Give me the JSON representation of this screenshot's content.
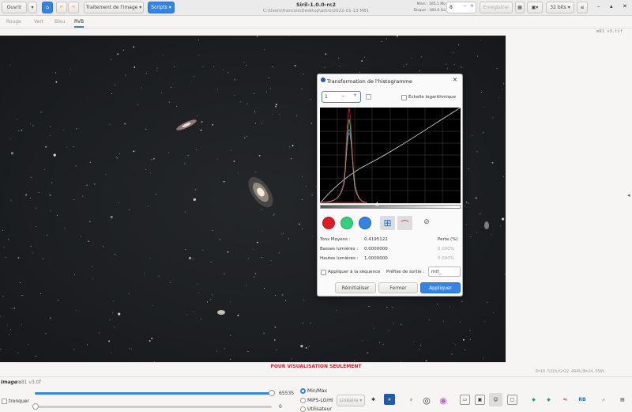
{
  "header": {
    "open_label": "Ouvrir",
    "image_processing_label": "Traitement de l'image",
    "scripts_label": "Scripts",
    "app_title": "Siril-1.0.0-rc2",
    "path": "C:\\Users\\francois\\Desktop\\astro\\2022-01-13 M81",
    "mem_label": "Mem : 185.1 Mo",
    "disk_label": "Disque : 383.0 Go",
    "threads_value": "8",
    "save_label": "Enregistrer",
    "bits_label": "32 bits"
  },
  "tabs": [
    {
      "label": "Rouge"
    },
    {
      "label": "Vert"
    },
    {
      "label": "Bleu"
    },
    {
      "label": "RVB"
    }
  ],
  "image": {
    "filename": "m81 v3.tif",
    "pixel_readout": "R=10.531%/G=22.494%/B=24.556%",
    "visual_banner": "POUR VISUALISATION SEULEMENT"
  },
  "bottom": {
    "image_label": "Image :",
    "image_value": "m81 v3.tif",
    "clip_label": "tronquer",
    "high_value": "65535",
    "low_value": "0",
    "radio_minmax": "Min/Max",
    "radio_mips": "MIPS-LO/HI",
    "radio_user": "Utilisateur",
    "scale_mode": "Linéaire"
  },
  "dialog": {
    "title": "Transformation de l'histogramme",
    "zoom_value": "1",
    "log_scale_label": "Échelle logarithmique",
    "midtones_label": "Tons Moyens :",
    "midtones_value": "0.4195122",
    "shadows_label": "Basses lumières :",
    "shadows_value": "0.0000000",
    "highlights_label": "Hautes lumières :",
    "highlights_value": "1.0000000",
    "loss_label": "Perte (%)",
    "shadows_loss": "0.000%",
    "highlights_loss": "0.000%",
    "apply_seq_label": "Appliquer à la séquence",
    "prefix_label": "Préfixe de sortie :",
    "prefix_value": "mtf_",
    "reset_label": "Réinitialiser",
    "close_label": "Fermer",
    "apply_label": "Appliquer"
  },
  "colors": {
    "accent": "#3584e4",
    "red": "#e01b24",
    "green": "#33d17a",
    "blue": "#3584e4"
  }
}
